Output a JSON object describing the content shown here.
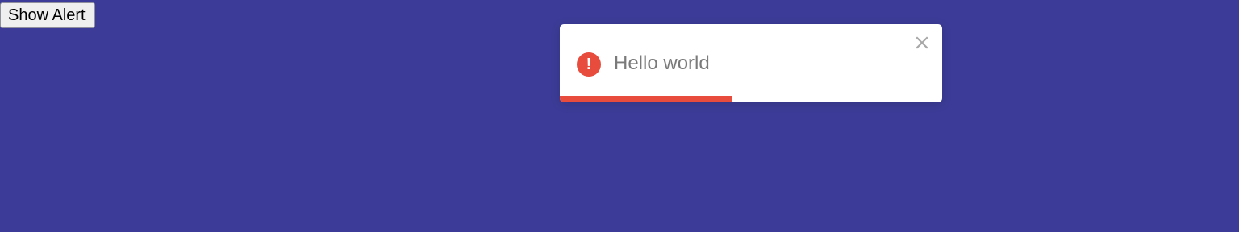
{
  "controls": {
    "show_alert_label": "Show Alert"
  },
  "toast": {
    "message": "Hello world",
    "icon": "alert-circle-icon",
    "icon_glyph": "!",
    "close_icon": "close-icon",
    "accent_color": "#e74c3c",
    "progress_fraction": 0.45
  },
  "theme": {
    "background_color": "#3c3c98",
    "toast_background": "#ffffff"
  }
}
